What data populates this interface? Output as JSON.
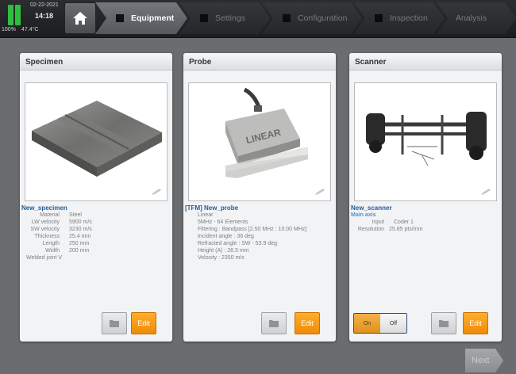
{
  "status": {
    "date": "02-22-2021",
    "time": "14:18",
    "battery": "100%",
    "temperature": "47.4°C"
  },
  "tabs": [
    {
      "label": "Equipment",
      "active": true
    },
    {
      "label": "Settings",
      "active": false
    },
    {
      "label": "Configuration",
      "active": false
    },
    {
      "label": "Inspection",
      "active": false
    },
    {
      "label": "Analysis",
      "active": false
    }
  ],
  "specimen": {
    "title": "Specimen",
    "name": "New_specimen",
    "props": [
      {
        "k": "Material",
        "v": "Steel"
      },
      {
        "k": "LW velocity",
        "v": "5900 m/s"
      },
      {
        "k": "SW velocity",
        "v": "3230 m/s"
      },
      {
        "k": "Thickness",
        "v": "25.4 mm"
      },
      {
        "k": "Length",
        "v": "250 mm"
      },
      {
        "k": "Width",
        "v": "200 mm"
      }
    ],
    "extra": "Welded joint V",
    "edit_label": "Edit"
  },
  "probe": {
    "title": "Probe",
    "name": "[TFM] New_probe",
    "lines": [
      "Linear",
      "5MHz - 64 Elements",
      "Filtering : Bandpass [2.50 MHz : 10.00 MHz]",
      "Incident angle : 36 deg",
      "Refracted angle : SW - 53.9 deg",
      "Height (A) : 26.5 mm",
      "Velocity : 2350 m/s"
    ],
    "wedge_text": "LINEAR",
    "edit_label": "Edit"
  },
  "scanner": {
    "title": "Scanner",
    "name": "New_scanner",
    "axis": "Main axis",
    "props": [
      {
        "k": "Input",
        "v": "Coder 1"
      },
      {
        "k": "Resolution",
        "v": "25.85 pts/mm"
      }
    ],
    "on_label": "On",
    "off_label": "Off",
    "edit_label": "Edit"
  },
  "next_label": "Next",
  "colors": {
    "accent_orange": "#f59a12",
    "link_blue": "#1f5d9e",
    "battery_green": "#2fbf3f"
  },
  "icons": [
    "home-icon",
    "folder-icon",
    "pencil-icon"
  ]
}
